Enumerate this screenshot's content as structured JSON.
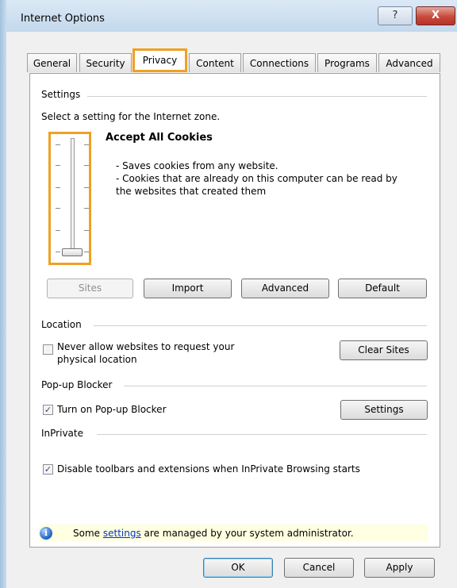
{
  "window": {
    "title": "Internet Options",
    "help_glyph": "?",
    "close_glyph": "X"
  },
  "tabs": [
    "General",
    "Security",
    "Privacy",
    "Content",
    "Connections",
    "Programs",
    "Advanced"
  ],
  "active_tab": "Privacy",
  "settings": {
    "group_label": "Settings",
    "instruction": "Select a setting for the Internet zone.",
    "level_title": "Accept All Cookies",
    "desc_line1": "- Saves cookies from any website.",
    "desc_line2": "- Cookies that are already on this computer can be read by",
    "desc_line3": "the websites that created them",
    "slider_level": "lowest",
    "buttons": {
      "sites": "Sites",
      "import": "Import",
      "advanced": "Advanced",
      "default": "Default"
    }
  },
  "location": {
    "group_label": "Location",
    "checkbox_line1": "Never allow websites to request your",
    "checkbox_line2": "physical location",
    "checked": false,
    "clear_sites": "Clear Sites"
  },
  "popup": {
    "group_label": "Pop-up Blocker",
    "checkbox_label": "Turn on Pop-up Blocker",
    "checked": true,
    "settings_button": "Settings"
  },
  "inprivate": {
    "group_label": "InPrivate",
    "checkbox_label": "Disable toolbars and extensions when InPrivate Browsing starts",
    "checked": true
  },
  "info": {
    "prefix": "Some ",
    "link": "settings",
    "suffix": " are managed by your system administrator."
  },
  "footer": {
    "ok": "OK",
    "cancel": "Cancel",
    "apply": "Apply"
  },
  "colors": {
    "highlight": "#f0a023",
    "info_bg": "#ffffe1",
    "link": "#0033cc"
  }
}
